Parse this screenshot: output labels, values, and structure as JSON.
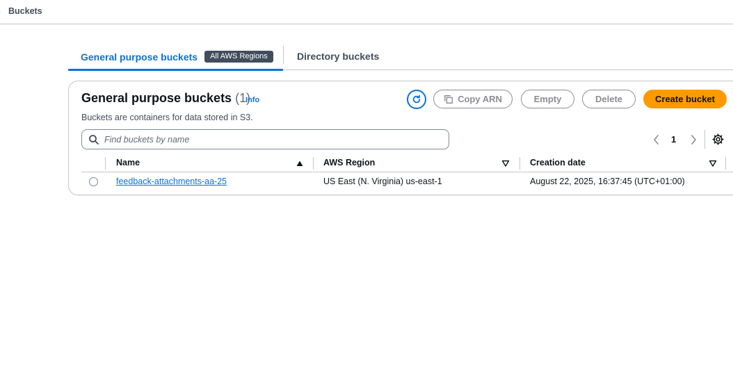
{
  "breadcrumb": {
    "current": "Buckets"
  },
  "tabs": {
    "general": {
      "label": "General purpose buckets",
      "badge": "All AWS Regions"
    },
    "directory": {
      "label": "Directory buckets"
    }
  },
  "panel": {
    "title": "General purpose buckets",
    "count": "(1)",
    "info": "Info",
    "description": "Buckets are containers for data stored in S3."
  },
  "actions": {
    "copy_arn": "Copy ARN",
    "empty": "Empty",
    "delete": "Delete",
    "create": "Create bucket"
  },
  "search": {
    "placeholder": "Find buckets by name",
    "value": ""
  },
  "pagination": {
    "current_page": "1"
  },
  "table": {
    "columns": [
      "Name",
      "AWS Region",
      "Creation date"
    ],
    "rows": [
      {
        "name": "feedback-attachments-aa-25",
        "region": "US East (N. Virginia) us-east-1",
        "created": "August 22, 2025, 16:37:45 (UTC+01:00)"
      }
    ]
  },
  "colors": {
    "accent": "#0972d3",
    "primary_button": "#ff9900",
    "badge": "#414d5c",
    "disabled": "#8c8c94"
  },
  "icons": [
    "refresh-icon",
    "copy-icon",
    "search-icon",
    "chevron-left-icon",
    "chevron-right-icon",
    "settings-icon",
    "sort-ascending-icon",
    "sort-descending-icon"
  ]
}
